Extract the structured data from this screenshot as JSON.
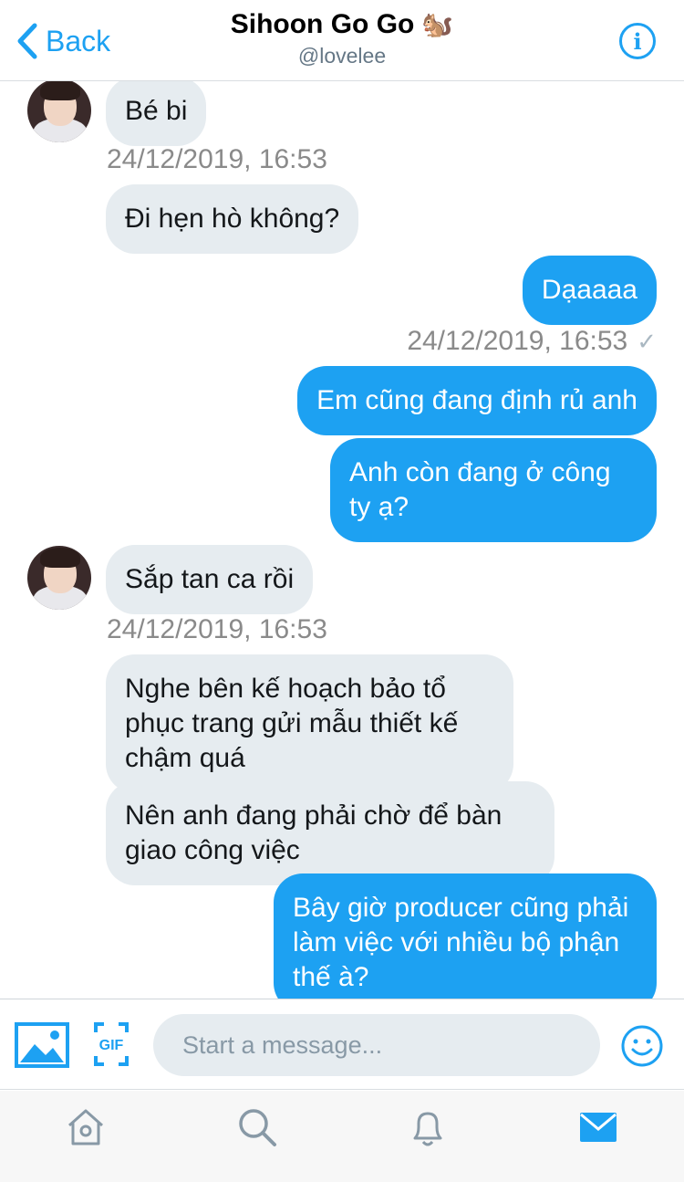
{
  "header": {
    "back_label": "Back",
    "title": "Sihoon Go Go",
    "title_emoji": "🐿️",
    "handle": "@lovelee",
    "info_icon": "info-icon",
    "accent": "#1da1f2"
  },
  "messages": {
    "m1": "Bé bi",
    "t1": "24/12/2019, 16:53",
    "m2": "Đi hẹn hò không?",
    "m3": "Dạaaaa",
    "t2": "24/12/2019, 16:53",
    "m4": "Em cũng đang định rủ anh",
    "m5": "Anh còn đang ở công ty ạ?",
    "m6": "Sắp tan ca rồi",
    "t3": "24/12/2019, 16:53",
    "m7": "Nghe bên kế hoạch bảo tổ phục trang gửi mẫu thiết kế chậm quá",
    "m8": "Nên anh đang phải chờ để bàn giao công việc",
    "m9": "Bây giờ producer cũng phải làm việc với nhiều bộ phận thế à?"
  },
  "composer": {
    "placeholder": "Start a message...",
    "gif_label": "GIF",
    "icons": [
      "photo-icon",
      "gif-icon",
      "emoji-icon"
    ]
  },
  "tabbar": {
    "tabs": [
      "home-icon",
      "search-icon",
      "notifications-icon",
      "messages-icon"
    ],
    "active": "messages-icon"
  },
  "colors": {
    "incoming_bubble": "#e6ecf0",
    "outgoing_bubble": "#1da1f2",
    "timestamp": "#8a8a8a"
  }
}
